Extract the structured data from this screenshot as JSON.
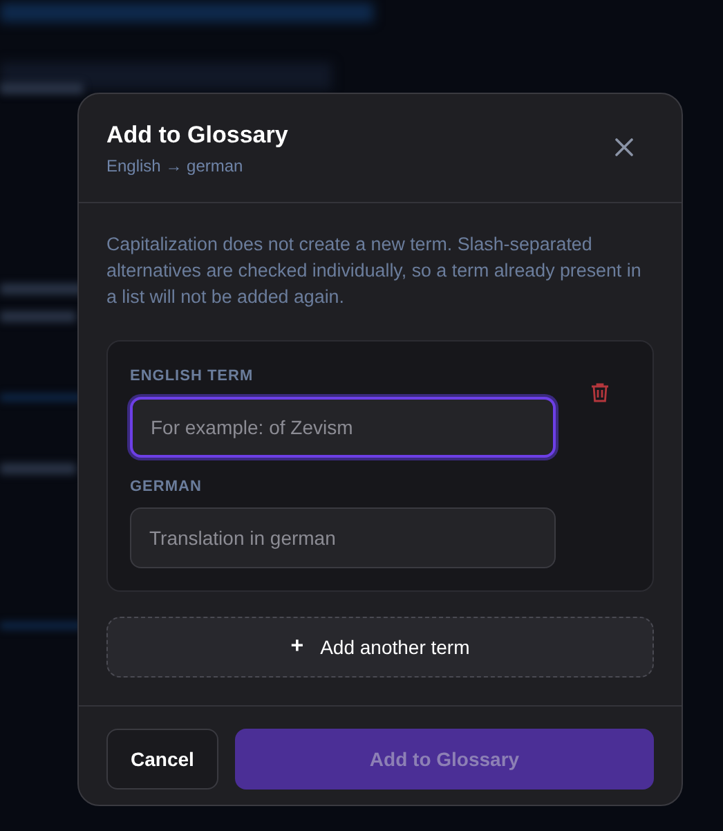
{
  "dialog": {
    "title": "Add to Glossary",
    "subtitle": "English → german",
    "description": "Capitalization does not create a new term. Slash-separated alternatives are checked individually, so a term already present in a list will not be added again.",
    "terms": [
      {
        "fields": [
          {
            "label": "ENGLISH TERM",
            "placeholder": "For example: of Zevism",
            "focused": true
          },
          {
            "label": "GERMAN",
            "placeholder": "Translation in german",
            "focused": false
          }
        ]
      }
    ],
    "add_term": {
      "icon": "+",
      "label": "Add another term"
    },
    "buttons": [
      {
        "kind": "secondary",
        "label": "Cancel",
        "disabled": false
      },
      {
        "kind": "primary",
        "label": "Add to Glossary",
        "disabled": true
      }
    ]
  }
}
